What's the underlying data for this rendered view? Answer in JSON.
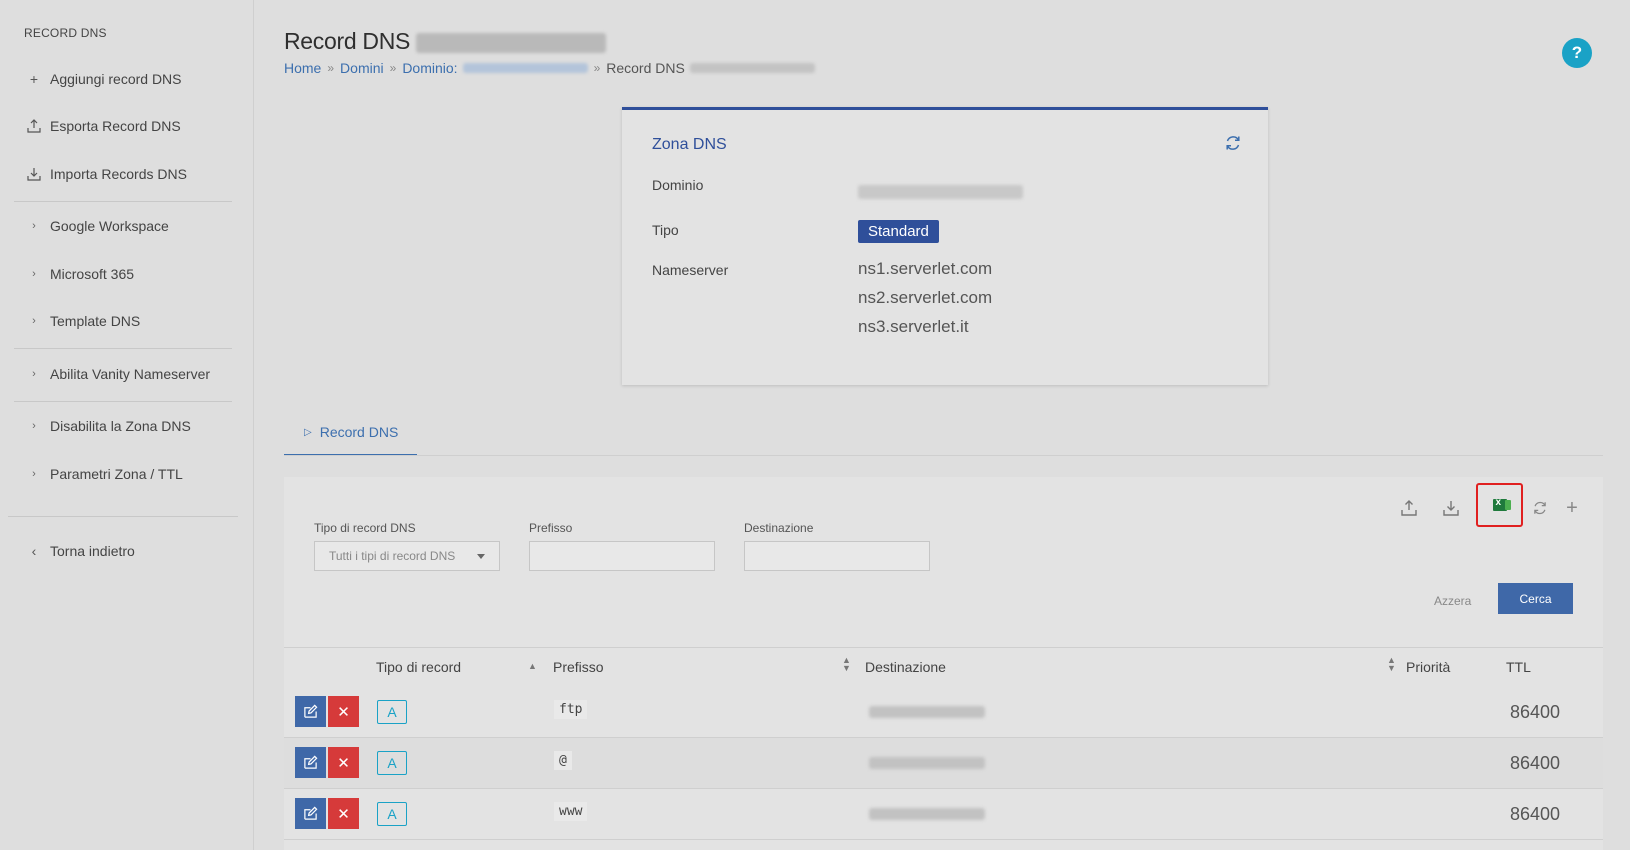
{
  "sidebar": {
    "title": "RECORD DNS",
    "items": [
      {
        "label": "Aggiungi record DNS",
        "icon": "plus-icon"
      },
      {
        "label": "Esporta Record DNS",
        "icon": "upload-icon"
      },
      {
        "label": "Importa Records DNS",
        "icon": "download-icon"
      },
      {
        "label": "Google Workspace",
        "icon": "chevron-right-icon"
      },
      {
        "label": "Microsoft 365",
        "icon": "chevron-right-icon"
      },
      {
        "label": "Template DNS",
        "icon": "chevron-right-icon"
      },
      {
        "label": "Abilita Vanity Nameserver",
        "icon": "chevron-right-icon"
      },
      {
        "label": "Disabilita la Zona DNS",
        "icon": "chevron-right-icon"
      },
      {
        "label": "Parametri Zona / TTL",
        "icon": "chevron-right-icon"
      },
      {
        "label": "Torna indietro",
        "icon": "chevron-left-icon"
      }
    ]
  },
  "header": {
    "title": "Record DNS",
    "breadcrumb": {
      "home": "Home",
      "domini": "Domini",
      "dominio": "Dominio:",
      "current": "Record DNS"
    },
    "help": "?"
  },
  "zone": {
    "title": "Zona DNS",
    "dominio_label": "Dominio",
    "tipo_label": "Tipo",
    "tipo_value": "Standard",
    "nameserver_label": "Nameserver",
    "nameservers": [
      "ns1.serverlet.com",
      "ns2.serverlet.com",
      "ns3.serverlet.it"
    ]
  },
  "tabs": {
    "active": "Record DNS"
  },
  "filters": {
    "type_label": "Tipo di record DNS",
    "type_value": "Tutti i tipi di record DNS",
    "prefix_label": "Prefisso",
    "dest_label": "Destinazione",
    "reset": "Azzera",
    "search": "Cerca"
  },
  "table": {
    "headers": {
      "type": "Tipo di record",
      "prefix": "Prefisso",
      "dest": "Destinazione",
      "priority": "Priorità",
      "ttl": "TTL"
    },
    "rows": [
      {
        "type": "A",
        "prefix": "ftp",
        "ttl": "86400"
      },
      {
        "type": "A",
        "prefix": "@",
        "ttl": "86400"
      },
      {
        "type": "A",
        "prefix": "www",
        "ttl": "86400"
      }
    ]
  },
  "colors": {
    "primary": "#3f68a8",
    "danger": "#d63a3a",
    "accent": "#1aa2c6",
    "zone_accent": "#2f4f9a",
    "highlight": "#e02020"
  }
}
